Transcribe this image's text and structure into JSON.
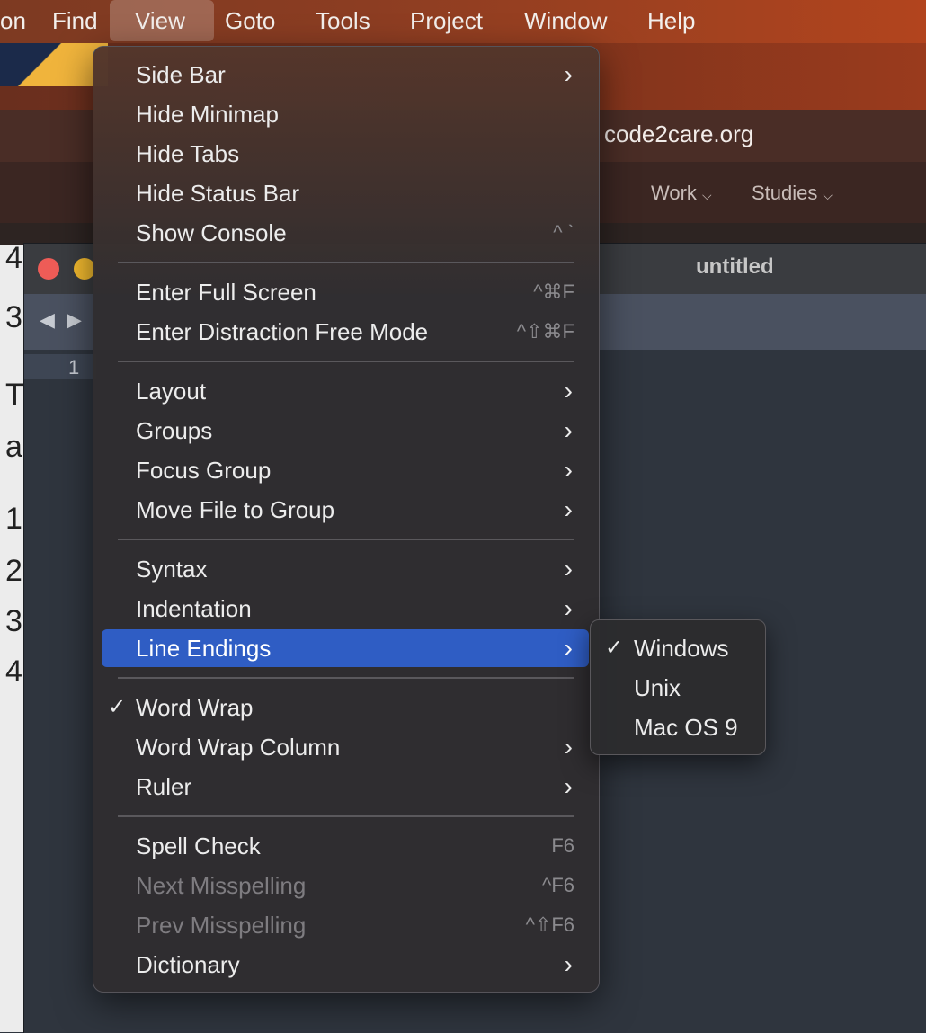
{
  "menubar": {
    "items": [
      {
        "label": "on"
      },
      {
        "label": "Find"
      },
      {
        "label": "View"
      },
      {
        "label": "Goto"
      },
      {
        "label": "Tools"
      },
      {
        "label": "Project"
      },
      {
        "label": "Window"
      },
      {
        "label": "Help"
      }
    ]
  },
  "browser": {
    "url": "code2care.org",
    "nav": [
      {
        "label": "Work"
      },
      {
        "label": "Studies"
      }
    ]
  },
  "background_page": {
    "chars": [
      "4",
      "3",
      "T",
      "a",
      "1",
      "2",
      "3",
      "4"
    ]
  },
  "editor": {
    "title": "untitled",
    "line_number": "1",
    "traffic_colors": {
      "close": "#ee5c57",
      "minimize": "#f5bc2f"
    }
  },
  "view_menu": {
    "items": [
      {
        "label": "Side Bar",
        "shortcut": "",
        "submenu": true
      },
      {
        "label": "Hide Minimap",
        "shortcut": ""
      },
      {
        "label": "Hide Tabs",
        "shortcut": ""
      },
      {
        "label": "Hide Status Bar",
        "shortcut": ""
      },
      {
        "label": "Show Console",
        "shortcut": "^ `"
      },
      {
        "label": "Enter Full Screen",
        "shortcut": "^⌘F"
      },
      {
        "label": "Enter Distraction Free Mode",
        "shortcut": "^⇧⌘F"
      },
      {
        "label": "Layout",
        "submenu": true
      },
      {
        "label": "Groups",
        "submenu": true
      },
      {
        "label": "Focus Group",
        "submenu": true
      },
      {
        "label": "Move File to Group",
        "submenu": true
      },
      {
        "label": "Syntax",
        "submenu": true
      },
      {
        "label": "Indentation",
        "submenu": true
      },
      {
        "label": "Line Endings",
        "submenu": true,
        "highlighted": true
      },
      {
        "label": "Word Wrap",
        "checked": true
      },
      {
        "label": "Word Wrap Column",
        "submenu": true
      },
      {
        "label": "Ruler",
        "submenu": true
      },
      {
        "label": "Spell Check",
        "shortcut": "F6"
      },
      {
        "label": "Next Misspelling",
        "shortcut": "^F6",
        "disabled": true
      },
      {
        "label": "Prev Misspelling",
        "shortcut": "^⇧F6",
        "disabled": true
      },
      {
        "label": "Dictionary",
        "submenu": true
      }
    ],
    "check_glyph": "✓",
    "arrow_glyph": "›"
  },
  "line_endings_submenu": {
    "items": [
      {
        "label": "Windows",
        "checked": true
      },
      {
        "label": "Unix"
      },
      {
        "label": "Mac OS 9"
      }
    ]
  },
  "colors": {
    "highlight": "#2f5dc4",
    "menu_bg": "#302d2f"
  }
}
